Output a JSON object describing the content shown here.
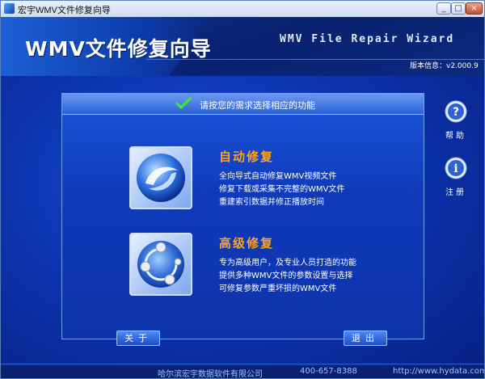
{
  "window": {
    "title": "宏宇WMV文件修复向导",
    "controls": {
      "minimize": "_",
      "maximize": "□",
      "close": "×"
    }
  },
  "header": {
    "title": "WMV文件修复向导",
    "subtitle": "WMV File Repair Wizard",
    "version": "版本信息：v2.000.9"
  },
  "panel": {
    "title": "请按您的需求选择相应的功能",
    "options": [
      {
        "title": "自动修复",
        "lines": [
          "全向导式自动修复WMV视频文件",
          "修复下载或采集不完整的WMV文件",
          "重建索引数据并修正播放时间"
        ]
      },
      {
        "title": "高级修复",
        "lines": [
          "专为高级用户，及专业人员打造的功能",
          "提供多种WMV文件的参数设置与选择",
          "可修复参数严重坏损的WMV文件"
        ]
      }
    ]
  },
  "side": {
    "help_label": "帮助",
    "register_label": "注册"
  },
  "buttons": {
    "about": "关于",
    "exit": "退出"
  },
  "footer": {
    "company": "哈尔滨宏宇数据软件有限公司",
    "phone": "400-657-8388",
    "url": "http://www.hydata.com"
  },
  "colors": {
    "background": "#0c34b0",
    "accent_orange": "#ffa21c",
    "panel_header": "#2c63d6"
  }
}
